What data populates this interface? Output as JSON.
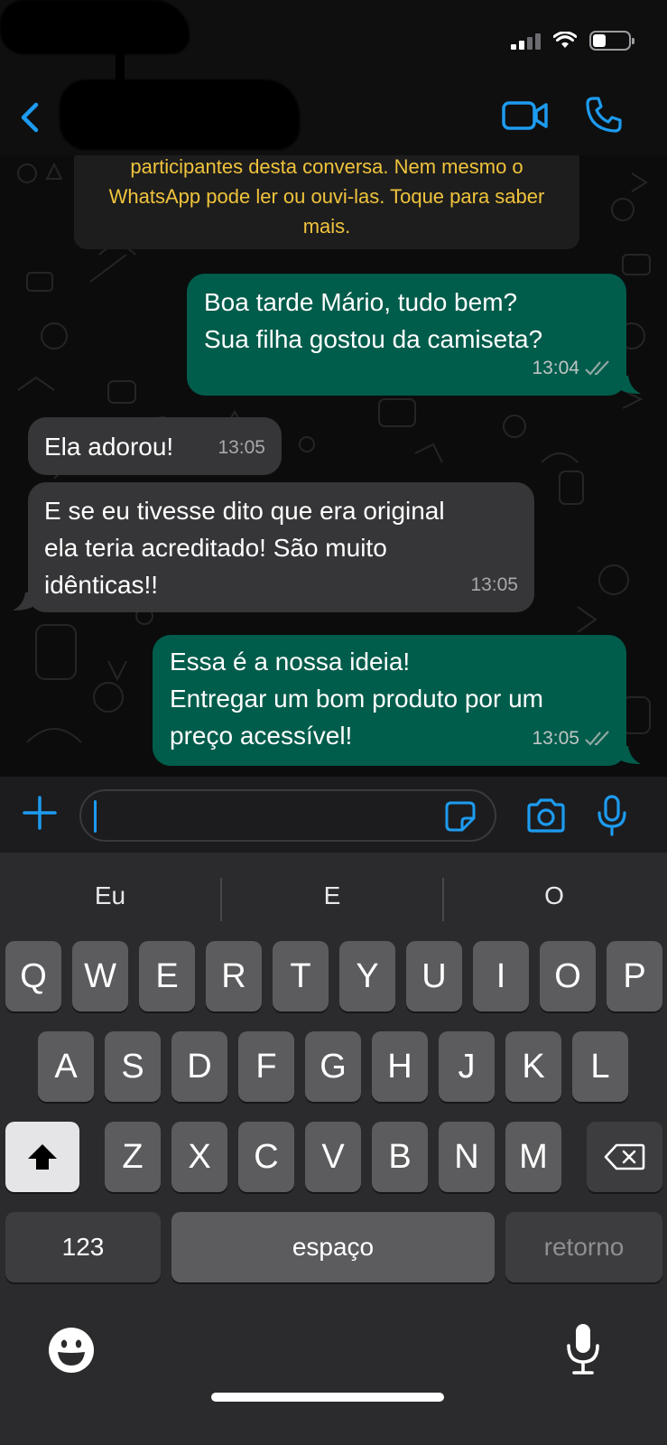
{
  "chat": {
    "encryption_notice": "participantes desta conversa. Nem mesmo o WhatsApp pode ler ou ouvi-las. Toque para saber mais.",
    "messages": [
      {
        "direction": "out",
        "text": "Boa tarde Mário, tudo bem?\nSua filha gostou da camiseta?",
        "time": "13:04",
        "status": "read"
      },
      {
        "direction": "in",
        "text": "Ela adorou!",
        "time": "13:05"
      },
      {
        "direction": "in",
        "text": "E se eu tivesse dito que era original\nela teria acreditado! São muito\nidênticas!!",
        "time": "13:05"
      },
      {
        "direction": "out",
        "text": "Essa é a nossa ideia!\nEntregar um bom produto por um\npreço acessível!",
        "time": "13:05",
        "status": "read"
      }
    ]
  },
  "input": {
    "value": ""
  },
  "keyboard": {
    "suggestions": [
      "Eu",
      "E",
      "O"
    ],
    "row1": [
      "Q",
      "W",
      "E",
      "R",
      "T",
      "Y",
      "U",
      "I",
      "O",
      "P"
    ],
    "row2": [
      "A",
      "S",
      "D",
      "F",
      "G",
      "H",
      "J",
      "K",
      "L"
    ],
    "row3": [
      "Z",
      "X",
      "C",
      "V",
      "B",
      "N",
      "M"
    ],
    "numbers_label": "123",
    "space_label": "espaço",
    "return_label": "retorno"
  },
  "colors": {
    "accent": "#1d9bf0",
    "outgoing_bubble": "#005c4b",
    "incoming_bubble": "#363638",
    "notice_text": "#f0c33c"
  },
  "icons": {
    "back": "chevron-left-icon",
    "video": "video-camera-icon",
    "call": "phone-icon",
    "attach": "plus-icon",
    "sticker": "sticker-icon",
    "camera": "camera-icon",
    "mic": "microphone-icon",
    "emoji": "emoji-icon",
    "read_receipt": "double-check-icon"
  }
}
